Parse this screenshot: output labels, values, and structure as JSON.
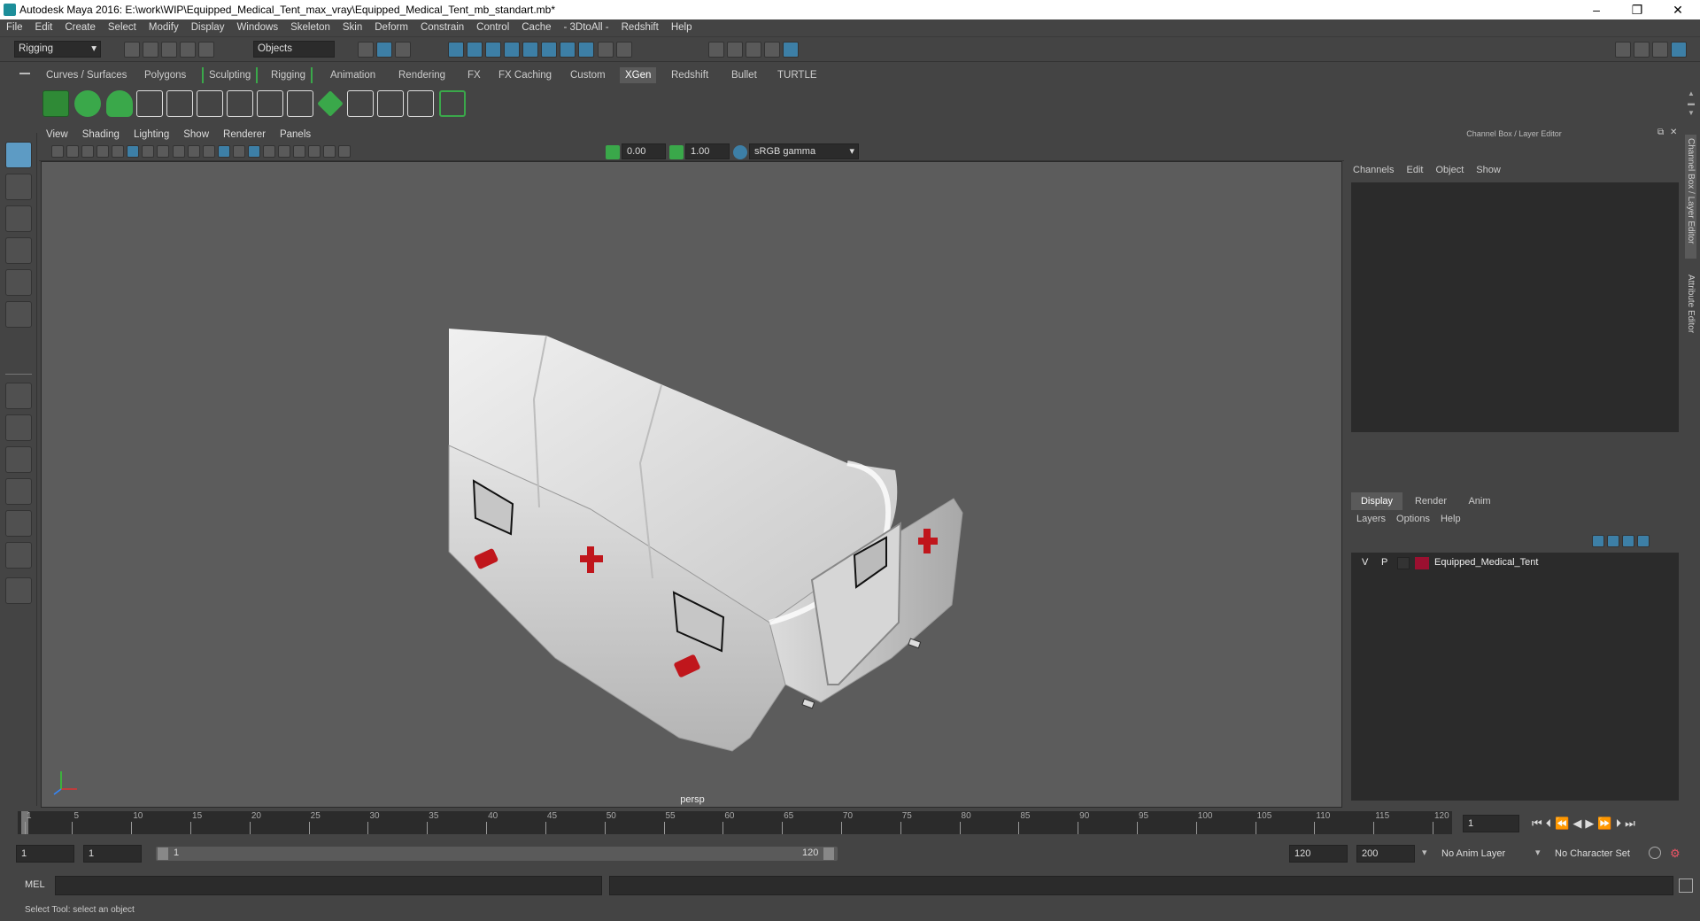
{
  "titlebar": {
    "title": "Autodesk Maya 2016: E:\\work\\WIP\\Equipped_Medical_Tent_max_vray\\Equipped_Medical_Tent_mb_standart.mb*"
  },
  "menu": [
    "File",
    "Edit",
    "Create",
    "Select",
    "Modify",
    "Display",
    "Windows",
    "Skeleton",
    "Skin",
    "Deform",
    "Constrain",
    "Control",
    "Cache",
    "- 3DtoAll -",
    "Redshift",
    "Help"
  ],
  "status": {
    "menuset": "Rigging",
    "select_mode": "Objects"
  },
  "shelf_tabs": [
    "Curves / Surfaces",
    "Polygons",
    "Sculpting",
    "Rigging",
    "Animation",
    "Rendering",
    "FX",
    "FX Caching",
    "Custom",
    "XGen",
    "Redshift",
    "Bullet",
    "TURTLE"
  ],
  "shelf_active": "XGen",
  "viewport": {
    "menu": [
      "View",
      "Shading",
      "Lighting",
      "Show",
      "Renderer",
      "Panels"
    ],
    "exposure": "0.00",
    "gamma": "1.00",
    "colorspace": "sRGB gamma",
    "camera": "persp"
  },
  "channelbox": {
    "title": "Channel Box / Layer Editor",
    "menu": [
      "Channels",
      "Edit",
      "Object",
      "Show"
    ]
  },
  "layereditor": {
    "tabs": [
      "Display",
      "Render",
      "Anim"
    ],
    "menu": [
      "Layers",
      "Options",
      "Help"
    ],
    "layer": {
      "v": "V",
      "p": "P",
      "name": "Equipped_Medical_Tent",
      "color": "#9b1030"
    }
  },
  "sidetabs": [
    "Channel Box / Layer Editor",
    "Attribute Editor"
  ],
  "timeline": {
    "ticks": [
      "1",
      "5",
      "10",
      "15",
      "20",
      "25",
      "30",
      "35",
      "40",
      "45",
      "50",
      "55",
      "60",
      "65",
      "70",
      "75",
      "80",
      "85",
      "90",
      "95",
      "100",
      "105",
      "110",
      "115",
      "120"
    ],
    "current_frame": "1"
  },
  "range": {
    "start": "1",
    "anim_start": "1",
    "slider_start": "1",
    "slider_end": "120",
    "anim_end": "120",
    "end": "200",
    "anim_layer": "No Anim Layer",
    "character_set": "No Character Set"
  },
  "cmdline": {
    "label": "MEL"
  },
  "helpline": {
    "text": "Select Tool: select an object"
  },
  "colors": {
    "accent": "#5d9bc4",
    "shelf_green": "#3aa84a",
    "cross_red": "#c0161c"
  }
}
